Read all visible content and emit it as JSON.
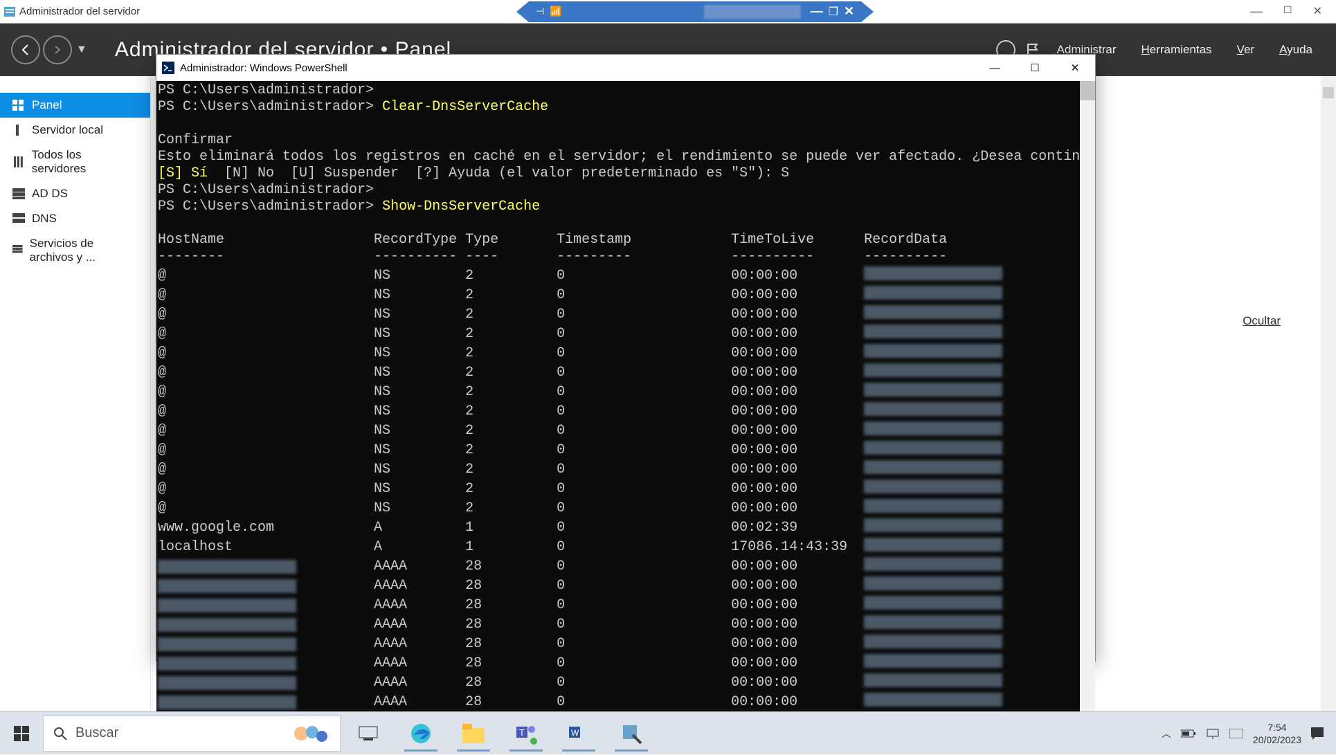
{
  "outer_window": {
    "title": "Administrador del servidor",
    "blue_strip_controls": [
      "−",
      "❐",
      "✕"
    ]
  },
  "server_manager": {
    "header_title": "Administrador del servidor • Panel",
    "menu": [
      "Administrar",
      "Herramientas",
      "Ver",
      "Ayuda"
    ],
    "hide_link": "Ocultar"
  },
  "sidebar": {
    "items": [
      {
        "label": "Panel"
      },
      {
        "label": "Servidor local"
      },
      {
        "label": "Todos los servidores"
      },
      {
        "label": "AD DS"
      },
      {
        "label": "DNS"
      },
      {
        "label": "Servicios de archivos y ..."
      }
    ]
  },
  "powershell": {
    "title": "Administrador: Windows PowerShell",
    "prompt": "PS C:\\Users\\administrador>",
    "cmd1": "Clear-DnsServerCache",
    "confirm_title": "Confirmar",
    "confirm_msg": "Esto eliminará todos los registros en caché en el servidor; el rendimiento se puede ver afectado. ¿Desea continuar?",
    "confirm_choices": "[S] Sí  [N] No  [U] Suspender  [?] Ayuda (el valor predeterminado es \"S\"): S",
    "cmd2": "Show-DnsServerCache",
    "columns": {
      "c1": "HostName",
      "c2": "RecordType",
      "c3": "Type",
      "c4": "Timestamp",
      "c5": "TimeToLive",
      "c6": "RecordData"
    },
    "col_sep": {
      "c1": "--------",
      "c2": "----------",
      "c3": "----",
      "c4": "---------",
      "c5": "----------",
      "c6": "----------"
    },
    "rows": [
      {
        "host": "@",
        "rtype": "NS",
        "type": "2",
        "ts": "0",
        "ttl": "00:00:00",
        "blur": true
      },
      {
        "host": "@",
        "rtype": "NS",
        "type": "2",
        "ts": "0",
        "ttl": "00:00:00",
        "blur": true
      },
      {
        "host": "@",
        "rtype": "NS",
        "type": "2",
        "ts": "0",
        "ttl": "00:00:00",
        "blur": true
      },
      {
        "host": "@",
        "rtype": "NS",
        "type": "2",
        "ts": "0",
        "ttl": "00:00:00",
        "blur": true
      },
      {
        "host": "@",
        "rtype": "NS",
        "type": "2",
        "ts": "0",
        "ttl": "00:00:00",
        "blur": true
      },
      {
        "host": "@",
        "rtype": "NS",
        "type": "2",
        "ts": "0",
        "ttl": "00:00:00",
        "blur": true
      },
      {
        "host": "@",
        "rtype": "NS",
        "type": "2",
        "ts": "0",
        "ttl": "00:00:00",
        "blur": true
      },
      {
        "host": "@",
        "rtype": "NS",
        "type": "2",
        "ts": "0",
        "ttl": "00:00:00",
        "blur": true
      },
      {
        "host": "@",
        "rtype": "NS",
        "type": "2",
        "ts": "0",
        "ttl": "00:00:00",
        "blur": true
      },
      {
        "host": "@",
        "rtype": "NS",
        "type": "2",
        "ts": "0",
        "ttl": "00:00:00",
        "blur": true
      },
      {
        "host": "@",
        "rtype": "NS",
        "type": "2",
        "ts": "0",
        "ttl": "00:00:00",
        "blur": true
      },
      {
        "host": "@",
        "rtype": "NS",
        "type": "2",
        "ts": "0",
        "ttl": "00:00:00",
        "blur": true
      },
      {
        "host": "@",
        "rtype": "NS",
        "type": "2",
        "ts": "0",
        "ttl": "00:00:00",
        "blur": true
      },
      {
        "host": "www.google.com",
        "rtype": "A",
        "type": "1",
        "ts": "0",
        "ttl": "00:02:39",
        "blur": true
      },
      {
        "host": "localhost",
        "rtype": "A",
        "type": "1",
        "ts": "0",
        "ttl": "17086.14:43:39",
        "blur": true
      },
      {
        "host": "",
        "hostblur": true,
        "rtype": "AAAA",
        "type": "28",
        "ts": "0",
        "ttl": "00:00:00",
        "blur": true
      },
      {
        "host": "",
        "hostblur": true,
        "rtype": "AAAA",
        "type": "28",
        "ts": "0",
        "ttl": "00:00:00",
        "blur": true
      },
      {
        "host": "",
        "hostblur": true,
        "rtype": "AAAA",
        "type": "28",
        "ts": "0",
        "ttl": "00:00:00",
        "blur": true
      },
      {
        "host": "",
        "hostblur": true,
        "rtype": "AAAA",
        "type": "28",
        "ts": "0",
        "ttl": "00:00:00",
        "blur": true
      },
      {
        "host": "",
        "hostblur": true,
        "rtype": "AAAA",
        "type": "28",
        "ts": "0",
        "ttl": "00:00:00",
        "blur": true
      },
      {
        "host": "",
        "hostblur": true,
        "rtype": "AAAA",
        "type": "28",
        "ts": "0",
        "ttl": "00:00:00",
        "blur": true
      },
      {
        "host": "",
        "hostblur": true,
        "rtype": "AAAA",
        "type": "28",
        "ts": "0",
        "ttl": "00:00:00",
        "blur": true
      },
      {
        "host": "",
        "hostblur": true,
        "rtype": "AAAA",
        "type": "28",
        "ts": "0",
        "ttl": "00:00:00",
        "blur": true
      }
    ]
  },
  "taskbar": {
    "search_placeholder": "Buscar",
    "time": "7:54",
    "date": "20/02/2023"
  }
}
